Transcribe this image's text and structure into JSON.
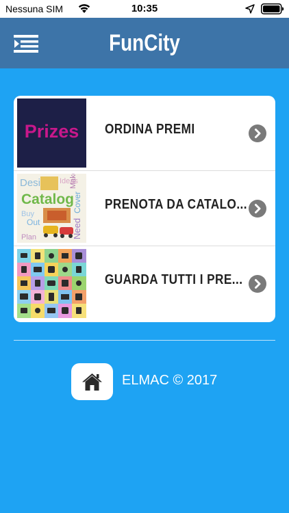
{
  "status_bar": {
    "carrier": "Nessuna SIM",
    "time": "10:35",
    "icons": [
      "wifi-icon",
      "location-arrow-icon",
      "battery-icon"
    ]
  },
  "nav": {
    "title": "FunCity",
    "menu_icon": "menu-list-icon"
  },
  "menu": {
    "items": [
      {
        "label": "ORDINA PREMI",
        "thumb_text": "Prizes",
        "icon": "chevron-right-icon"
      },
      {
        "label": "PRENOTA DA CATALO...",
        "thumb_text": "Catalog",
        "icon": "chevron-right-icon"
      },
      {
        "label": "GUARDA TUTTI I PRE...",
        "thumb_text": "",
        "icon": "chevron-right-icon"
      }
    ]
  },
  "footer": {
    "home_icon": "home-icon",
    "text": "ELMAC © 2017"
  },
  "colors": {
    "background": "#1ea3f3",
    "nav_bar": "#3d74a8",
    "prizes_bg": "#1d1f47",
    "prizes_text": "#c8188b"
  }
}
